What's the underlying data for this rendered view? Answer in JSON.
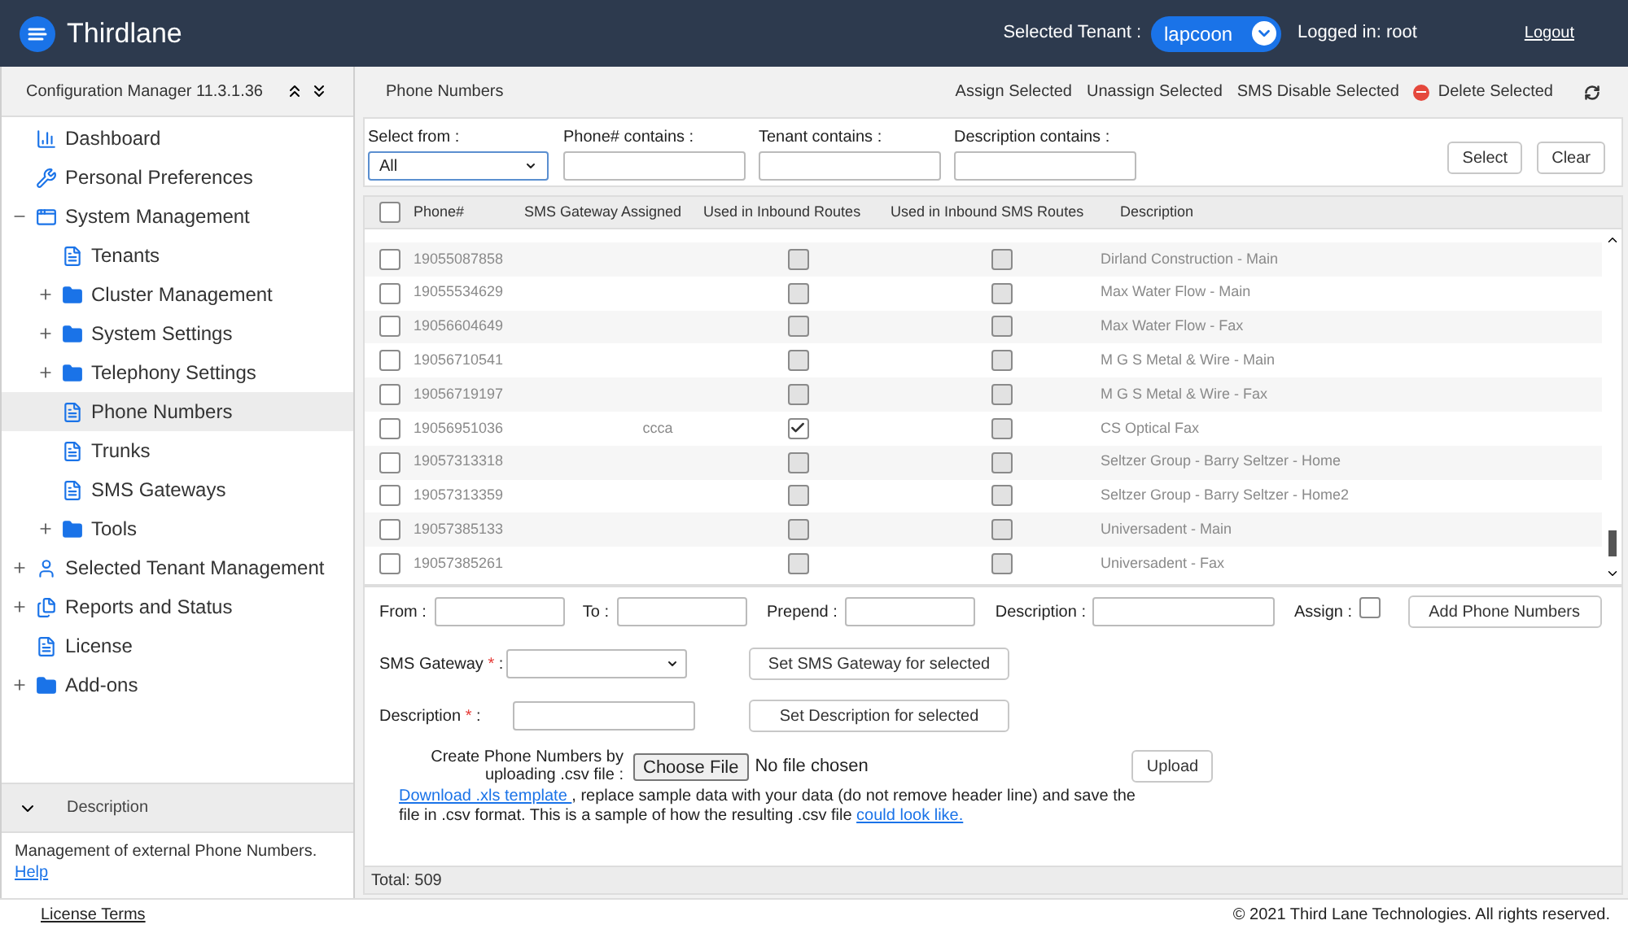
{
  "header": {
    "app_name": "Thirdlane",
    "tenant_label": "Selected Tenant :",
    "tenant": "lapcoon",
    "logged_in": "Logged in: root",
    "logout": "Logout"
  },
  "sidebar": {
    "title": "Configuration Manager 11.3.1.36",
    "tree": [
      {
        "label": "Dashboard",
        "kind": "chart",
        "selected": false
      },
      {
        "label": "Personal Preferences",
        "kind": "wrench",
        "selected": false
      },
      {
        "label": "System Management",
        "kind": "window",
        "selected": false,
        "expanded": true,
        "children": [
          {
            "label": "Tenants",
            "kind": "page",
            "selected": false
          },
          {
            "label": "Cluster Management",
            "kind": "folder",
            "selected": false,
            "expanded": false
          },
          {
            "label": "System Settings",
            "kind": "folder",
            "selected": false,
            "expanded": false
          },
          {
            "label": "Telephony Settings",
            "kind": "folder",
            "selected": false,
            "expanded": false
          },
          {
            "label": "Phone Numbers",
            "kind": "page",
            "selected": true
          },
          {
            "label": "Trunks",
            "kind": "page",
            "selected": false
          },
          {
            "label": "SMS Gateways",
            "kind": "page",
            "selected": false
          },
          {
            "label": "Tools",
            "kind": "folder",
            "selected": false,
            "expanded": false
          }
        ]
      },
      {
        "label": "Selected Tenant Management",
        "kind": "person",
        "selected": false,
        "expanded": false
      },
      {
        "label": "Reports and Status",
        "kind": "pages",
        "selected": false,
        "expanded": false
      },
      {
        "label": "License",
        "kind": "page",
        "selected": false
      },
      {
        "label": "Add-ons",
        "kind": "folder",
        "selected": false,
        "expanded": false
      }
    ],
    "description_title": "Description",
    "description": "Management of external Phone Numbers.",
    "help_link": "Help"
  },
  "footer": {
    "license": "License Terms",
    "copyright": "© 2021 Third Lane Technologies. All rights reserved."
  },
  "panel": {
    "title": "Phone Numbers",
    "actions": [
      {
        "label": "Assign Selected",
        "kind": "plain"
      },
      {
        "label": "Unassign Selected",
        "kind": "plain"
      },
      {
        "label": "SMS Disable Selected",
        "kind": "plain"
      },
      {
        "label": "Delete Selected",
        "kind": "delete"
      }
    ]
  },
  "filters": {
    "select_from_label": "Select from :",
    "select_from_value": "All",
    "phone_label": "Phone# contains  :",
    "tenant_label": "Tenant contains  :",
    "description_label": "Description contains  :",
    "select_button": "Select",
    "clear_button": "Clear"
  },
  "table": {
    "select_all_checked": false,
    "columns": [
      "Phone#",
      "SMS Gateway Assigned",
      "Used in Inbound Routes",
      "Used in Inbound SMS Routes",
      "Description"
    ],
    "rows": [
      {
        "phone": "19055087858",
        "gateway": "",
        "inbound": false,
        "sms": false,
        "description": "Dirland Construction - Main",
        "checked": false
      },
      {
        "phone": "19055534629",
        "gateway": "",
        "inbound": false,
        "sms": false,
        "description": "Max Water Flow - Main",
        "checked": false
      },
      {
        "phone": "19056604649",
        "gateway": "",
        "inbound": false,
        "sms": false,
        "description": "Max Water Flow - Fax",
        "checked": false
      },
      {
        "phone": "19056710541",
        "gateway": "",
        "inbound": false,
        "sms": false,
        "description": "M G S Metal & Wire - Main",
        "checked": false
      },
      {
        "phone": "19056719197",
        "gateway": "",
        "inbound": false,
        "sms": false,
        "description": "M G S Metal & Wire - Fax",
        "checked": false
      },
      {
        "phone": "19056951036",
        "gateway": "ccca",
        "inbound": true,
        "sms": false,
        "description": "CS Optical Fax",
        "checked": false
      },
      {
        "phone": "19057313318",
        "gateway": "",
        "inbound": false,
        "sms": false,
        "description": "Seltzer Group - Barry Seltzer - Home",
        "checked": false
      },
      {
        "phone": "19057313359",
        "gateway": "",
        "inbound": false,
        "sms": false,
        "description": "Seltzer Group - Barry Seltzer - Home2",
        "checked": false
      },
      {
        "phone": "19057385133",
        "gateway": "",
        "inbound": false,
        "sms": false,
        "description": "Universadent - Main",
        "checked": false
      },
      {
        "phone": "19057385261",
        "gateway": "",
        "inbound": false,
        "sms": false,
        "description": "Universadent - Fax",
        "checked": false
      }
    ]
  },
  "add_form": {
    "from_label": "From :",
    "to_label": "To :",
    "prepend_label": "Prepend :",
    "description_label": "Description :",
    "assign_label": "Assign :",
    "assign_checked": false,
    "add_button": "Add Phone Numbers",
    "gateway_label": "SMS Gateway",
    "gateway_button": "Set SMS Gateway for selected",
    "desc2_label": "Description",
    "desc_button": "Set Description for selected",
    "required_mark": "*",
    "colon": ":",
    "upload_label": "Create Phone Numbers by uploading .csv file :",
    "choose_file": "Choose File",
    "no_file": "No file chosen",
    "upload_button": "Upload",
    "template_link": "Download .xls template ",
    "note_1": ", replace sample data with your data (do not remove header line) and save the file in .csv format.  This is a sample of how the resulting .csv file ",
    "sample_link": "could look like."
  },
  "total": "Total: 509"
}
